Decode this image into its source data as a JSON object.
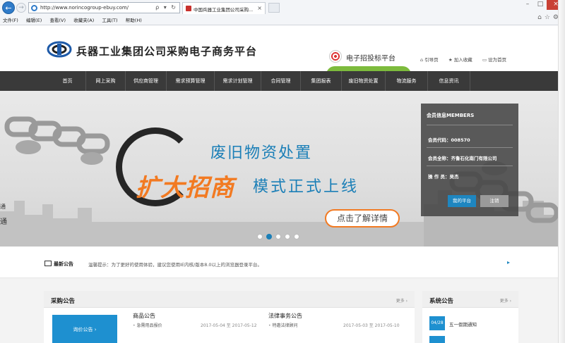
{
  "browser": {
    "url": "http://www.norincogroup-ebuy.com/",
    "address_tools": "ρ ▾ ↻",
    "tab_title": "中国兵器工业集团公司采购...",
    "menu": [
      "文件(F)",
      "编辑(E)",
      "查看(V)",
      "收藏夹(A)",
      "工具(T)",
      "帮助(H)"
    ]
  },
  "site": {
    "title": "兵器工业集团公司采购电子商务平台",
    "bid_platform": "电子招投标平台",
    "header_links": [
      {
        "icon": "home-icon",
        "label": "引导页"
      },
      {
        "icon": "star-icon",
        "label": "加入收藏"
      },
      {
        "icon": "monitor-icon",
        "label": "设为首页"
      }
    ]
  },
  "nav": {
    "items": [
      "首页",
      "网上采购",
      "供应商管理",
      "需求预算管理",
      "需求计划管理",
      "合同管理",
      "集团报表",
      "废旧物资处置",
      "物流服务",
      "信息资讯"
    ]
  },
  "hero": {
    "line1": "废旧物资处置",
    "line2_highlight": "扩大招商",
    "line2_rest": "模式正式上线",
    "cta": "点击了解详情",
    "left_text_top": "通",
    "left_text_bottom": "通",
    "dots_count": 5,
    "active_dot": 1
  },
  "member": {
    "title": "会员信息MEMBERS",
    "rows": [
      {
        "label": "会员代码：",
        "value": "008570"
      },
      {
        "label": "会员全称：",
        "value": "齐鲁石化南门有限公司"
      },
      {
        "label": "操 作 员：",
        "value": "吴杰"
      }
    ],
    "my_platform": "我的平台",
    "logout": "注销"
  },
  "notice": {
    "label": "最新公告",
    "text": "温馨提示：为了更好的使用体验，建议您使用IE内核/版本8.0以上的浏览器登录平台。",
    "arrow": "▸"
  },
  "procurement": {
    "title": "采购公告",
    "more": "更多 ›",
    "tile": "询价公告 ›",
    "columns": [
      {
        "heading": "商品公告",
        "item": "急需用品报价",
        "date": "2017-05-04 至 2017-05-12"
      },
      {
        "heading": "法律事务公告",
        "item": "特邀法律顾问",
        "date": "2017-05-03 至 2017-05-10"
      }
    ]
  },
  "system": {
    "title": "系统公告",
    "more": "更多 ›",
    "date": "04/28",
    "item": "五一假期通知"
  },
  "colors": {
    "nav_bg": "#3a3a3a",
    "accent_blue": "#1e86c0",
    "accent_orange": "#f27a22",
    "close_red": "#c94135"
  }
}
